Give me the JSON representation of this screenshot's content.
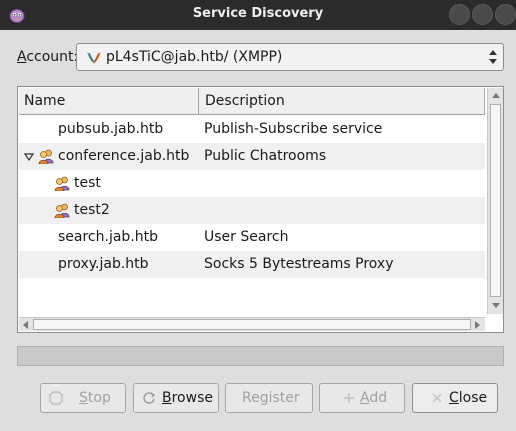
{
  "window": {
    "title": "Service Discovery",
    "app_icon": "pidgin-icon"
  },
  "account": {
    "label_underlined": "A",
    "label_rest": "ccount:",
    "value": "pL4sTiC@jab.htb/ (XMPP)",
    "icon": "xmpp-icon"
  },
  "tree": {
    "columns": {
      "name": "Name",
      "description": "Description"
    },
    "rows": [
      {
        "name": "pubsub.jab.htb",
        "description": "Publish-Subscribe service",
        "icon": "",
        "level": 0,
        "expanded": null
      },
      {
        "name": "conference.jab.htb",
        "description": "Public Chatrooms",
        "icon": "chatroom-icon",
        "level": 0,
        "expanded": true
      },
      {
        "name": "test",
        "description": "",
        "icon": "chatroom-icon",
        "level": 1,
        "expanded": null
      },
      {
        "name": "test2",
        "description": "",
        "icon": "chatroom-icon",
        "level": 1,
        "expanded": null
      },
      {
        "name": "search.jab.htb",
        "description": "User Search",
        "icon": "",
        "level": 0,
        "expanded": null
      },
      {
        "name": "proxy.jab.htb",
        "description": "Socks 5 Bytestreams Proxy",
        "icon": "",
        "level": 0,
        "expanded": null
      }
    ]
  },
  "progress": {
    "value": 0
  },
  "buttons": {
    "stop": {
      "underlined": "S",
      "rest": "top",
      "enabled": false,
      "icon": "stop-icon"
    },
    "browse": {
      "underlined": "B",
      "rest": "rowse",
      "enabled": true,
      "icon": "refresh-icon"
    },
    "register": {
      "label": "Register",
      "enabled": false
    },
    "add": {
      "underlined": "A",
      "rest": "dd",
      "enabled": false,
      "icon": "add-icon"
    },
    "close": {
      "underlined": "C",
      "rest": "lose",
      "enabled": true,
      "icon": "close-icon"
    }
  },
  "colors": {
    "titlebar": "#2b2b2b",
    "window_bg": "#dedede",
    "row_alt": "#f0f0f0",
    "disabled_text": "#a2a2a2"
  }
}
